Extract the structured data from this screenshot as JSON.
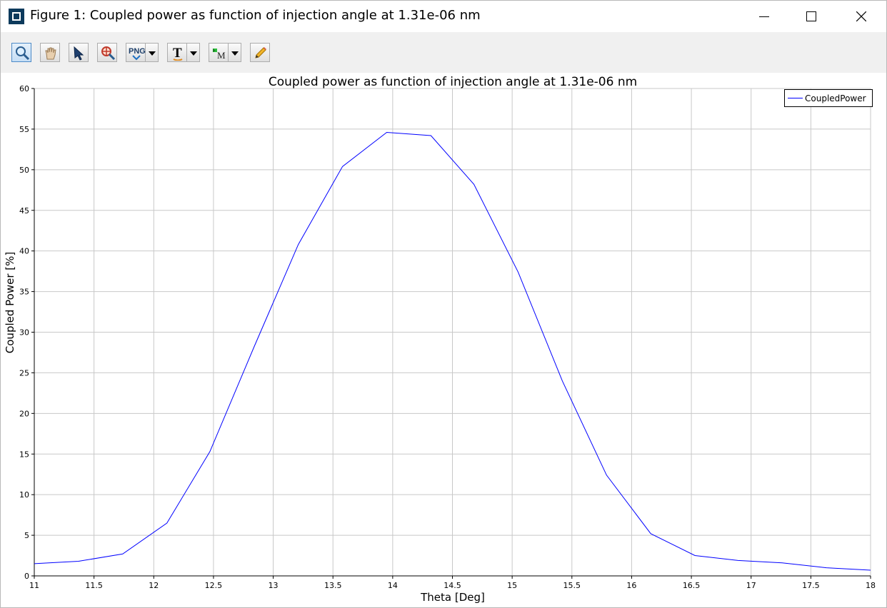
{
  "window": {
    "title": "Figure 1: Coupled power as function of injection angle at 1.31e-06 nm"
  },
  "toolbar": {
    "tools": [
      {
        "name": "zoom-tool",
        "icon": "magnifier-icon",
        "active": true
      },
      {
        "name": "pan-tool",
        "icon": "hand-icon"
      },
      {
        "name": "select-tool",
        "icon": "arrow-cursor-icon"
      },
      {
        "name": "zoom-target-tool",
        "icon": "target-zoom-icon"
      },
      {
        "name": "export-png-tool",
        "icon": "png-export-icon",
        "label": "PNG",
        "dropdown": true
      },
      {
        "name": "text-tool",
        "icon": "text-t-icon",
        "label": "T",
        "dropdown": true
      },
      {
        "name": "marker-tool",
        "icon": "marker-m-icon",
        "label": "M",
        "dropdown": true
      },
      {
        "name": "edit-tool",
        "icon": "pencil-icon"
      }
    ]
  },
  "chart_data": {
    "type": "line",
    "title": "Coupled power as function of injection angle at 1.31e-06 nm",
    "xlabel": "Theta [Deg]",
    "ylabel": "Coupled Power [%]",
    "xlim": [
      11,
      18
    ],
    "ylim": [
      0,
      60
    ],
    "xticks": [
      11,
      11.5,
      12,
      12.5,
      13,
      13.5,
      14,
      14.5,
      15,
      15.5,
      16,
      16.5,
      17,
      17.5,
      18
    ],
    "xtick_labels": [
      "11",
      "11.5",
      "12",
      "12.5",
      "13",
      "13.5",
      "14",
      "14.5",
      "15",
      "15.5",
      "16",
      "16.5",
      "17",
      "17.5",
      "18"
    ],
    "yticks": [
      0,
      5,
      10,
      15,
      20,
      25,
      30,
      35,
      40,
      45,
      50,
      55,
      60
    ],
    "ytick_labels": [
      "0",
      "5",
      "10",
      "15",
      "20",
      "25",
      "30",
      "35",
      "40",
      "45",
      "50",
      "55",
      "60"
    ],
    "grid": true,
    "legend_position": "top-right",
    "series": [
      {
        "name": "CoupledPower",
        "color": "#0000ff",
        "x": [
          11.0,
          11.37,
          11.74,
          12.11,
          12.47,
          12.84,
          13.21,
          13.58,
          13.95,
          14.32,
          14.68,
          15.05,
          15.42,
          15.79,
          16.16,
          16.53,
          16.89,
          17.26,
          17.63,
          18.0
        ],
        "y": [
          1.5,
          1.8,
          2.7,
          6.5,
          15.3,
          28.2,
          40.8,
          50.4,
          54.6,
          54.2,
          48.2,
          37.4,
          24.0,
          12.4,
          5.2,
          2.5,
          1.9,
          1.6,
          1.0,
          0.7
        ]
      }
    ]
  },
  "colors": {
    "toolbar_bg": "#f0f0f0",
    "grid": "#c8c8c8",
    "series": "#0000ff",
    "app_icon": "#0d3a5c"
  }
}
